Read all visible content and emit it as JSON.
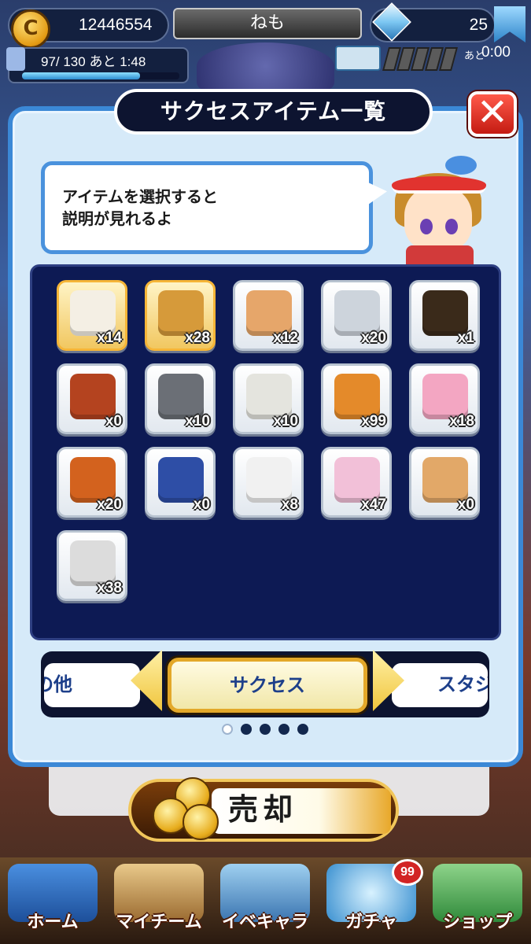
{
  "header": {
    "coins": "12446554",
    "player_name": "ねも",
    "gems": "25",
    "stamina": "97/ 130",
    "stamina_recover": "あと 1:48",
    "stamina_level": 0.75,
    "event_timer_label": "あと",
    "event_timer": "0:00"
  },
  "modal": {
    "title": "サクセスアイテム一覧",
    "close_label": "✕",
    "hint_line1": "アイテムを選択すると",
    "hint_line2": "説明が見れるよ"
  },
  "items": [
    {
      "icon": "document-icon",
      "count": "x14",
      "selected": true
    },
    {
      "icon": "success-charm-icon",
      "count": "x28",
      "selected": true
    },
    {
      "icon": "baseball-tag-icon",
      "count": "x12",
      "selected": false
    },
    {
      "icon": "blade-icon",
      "count": "x20",
      "selected": false
    },
    {
      "icon": "max-bottle-icon",
      "count": "x1",
      "selected": false
    },
    {
      "icon": "medicine-bottle-icon",
      "count": "x0",
      "selected": false
    },
    {
      "icon": "pipe-joint-icon",
      "count": "x10",
      "selected": false
    },
    {
      "icon": "aroma-pot-icon",
      "count": "x10",
      "selected": false
    },
    {
      "icon": "dog-bowl-icon",
      "count": "x99",
      "selected": false
    },
    {
      "icon": "heart-charm-icon",
      "count": "x18",
      "selected": false
    },
    {
      "icon": "racket-icon",
      "count": "x20",
      "selected": false
    },
    {
      "icon": "drink-bottle-icon",
      "count": "x0",
      "selected": false
    },
    {
      "icon": "lucky-cat-icon",
      "count": "x8",
      "selected": false
    },
    {
      "icon": "gift-box-icon",
      "count": "x47",
      "selected": false
    },
    {
      "icon": "pawa-bars-icon",
      "count": "x0",
      "selected": false
    },
    {
      "icon": "robot-head-icon",
      "count": "x38",
      "selected": false
    }
  ],
  "category": {
    "prev": "の他",
    "current": "サクセス",
    "next": "スタジ",
    "page_count": 5,
    "active_page": 1
  },
  "sell_button": {
    "label": "売却"
  },
  "nav": [
    {
      "label": "ホーム"
    },
    {
      "label": "マイチーム"
    },
    {
      "label": "イベキャラ"
    },
    {
      "label": "ガチャ",
      "badge": "99"
    },
    {
      "label": "ショップ"
    }
  ]
}
